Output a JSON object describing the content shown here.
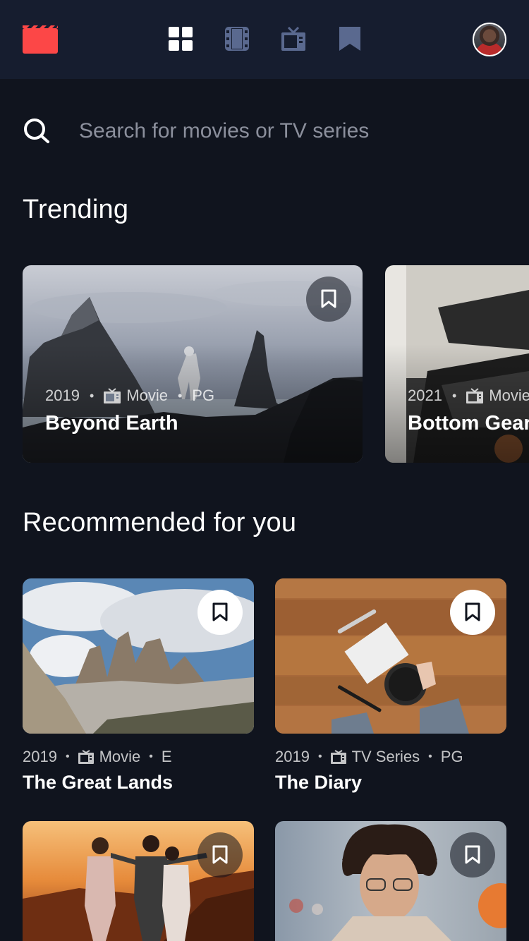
{
  "nav": {
    "logo_icon": "clapperboard-icon",
    "items": [
      {
        "name": "home",
        "icon": "grid-icon",
        "active": true
      },
      {
        "name": "movies",
        "icon": "film-icon",
        "active": false
      },
      {
        "name": "tv",
        "icon": "tv-icon",
        "active": false
      },
      {
        "name": "bookmarks",
        "icon": "bookmark-icon",
        "active": false
      }
    ],
    "avatar_icon": "user-avatar"
  },
  "search": {
    "placeholder": "Search for movies or TV series",
    "value": ""
  },
  "trending": {
    "title": "Trending",
    "items": [
      {
        "year": "2019",
        "category": "Movie",
        "rating": "PG",
        "title": "Beyond Earth",
        "bookmarked": false
      },
      {
        "year": "2021",
        "category": "Movie",
        "rating": "",
        "title": "Bottom Gear",
        "bookmarked": false
      }
    ]
  },
  "recommended": {
    "title": "Recommended for you",
    "items": [
      {
        "year": "2019",
        "category": "Movie",
        "rating": "E",
        "title": "The Great Lands",
        "bookmarked": false
      },
      {
        "year": "2019",
        "category": "TV Series",
        "rating": "PG",
        "title": "The Diary",
        "bookmarked": false
      },
      {
        "year": "",
        "category": "",
        "rating": "",
        "title": "",
        "bookmarked": false
      },
      {
        "year": "",
        "category": "",
        "rating": "",
        "title": "",
        "bookmarked": false
      }
    ]
  },
  "colors": {
    "background": "#10141e",
    "surface": "#161d2f",
    "accent_red": "#fc4747",
    "nav_inactive": "#5a698f",
    "text_muted": "#8b8f9c"
  }
}
